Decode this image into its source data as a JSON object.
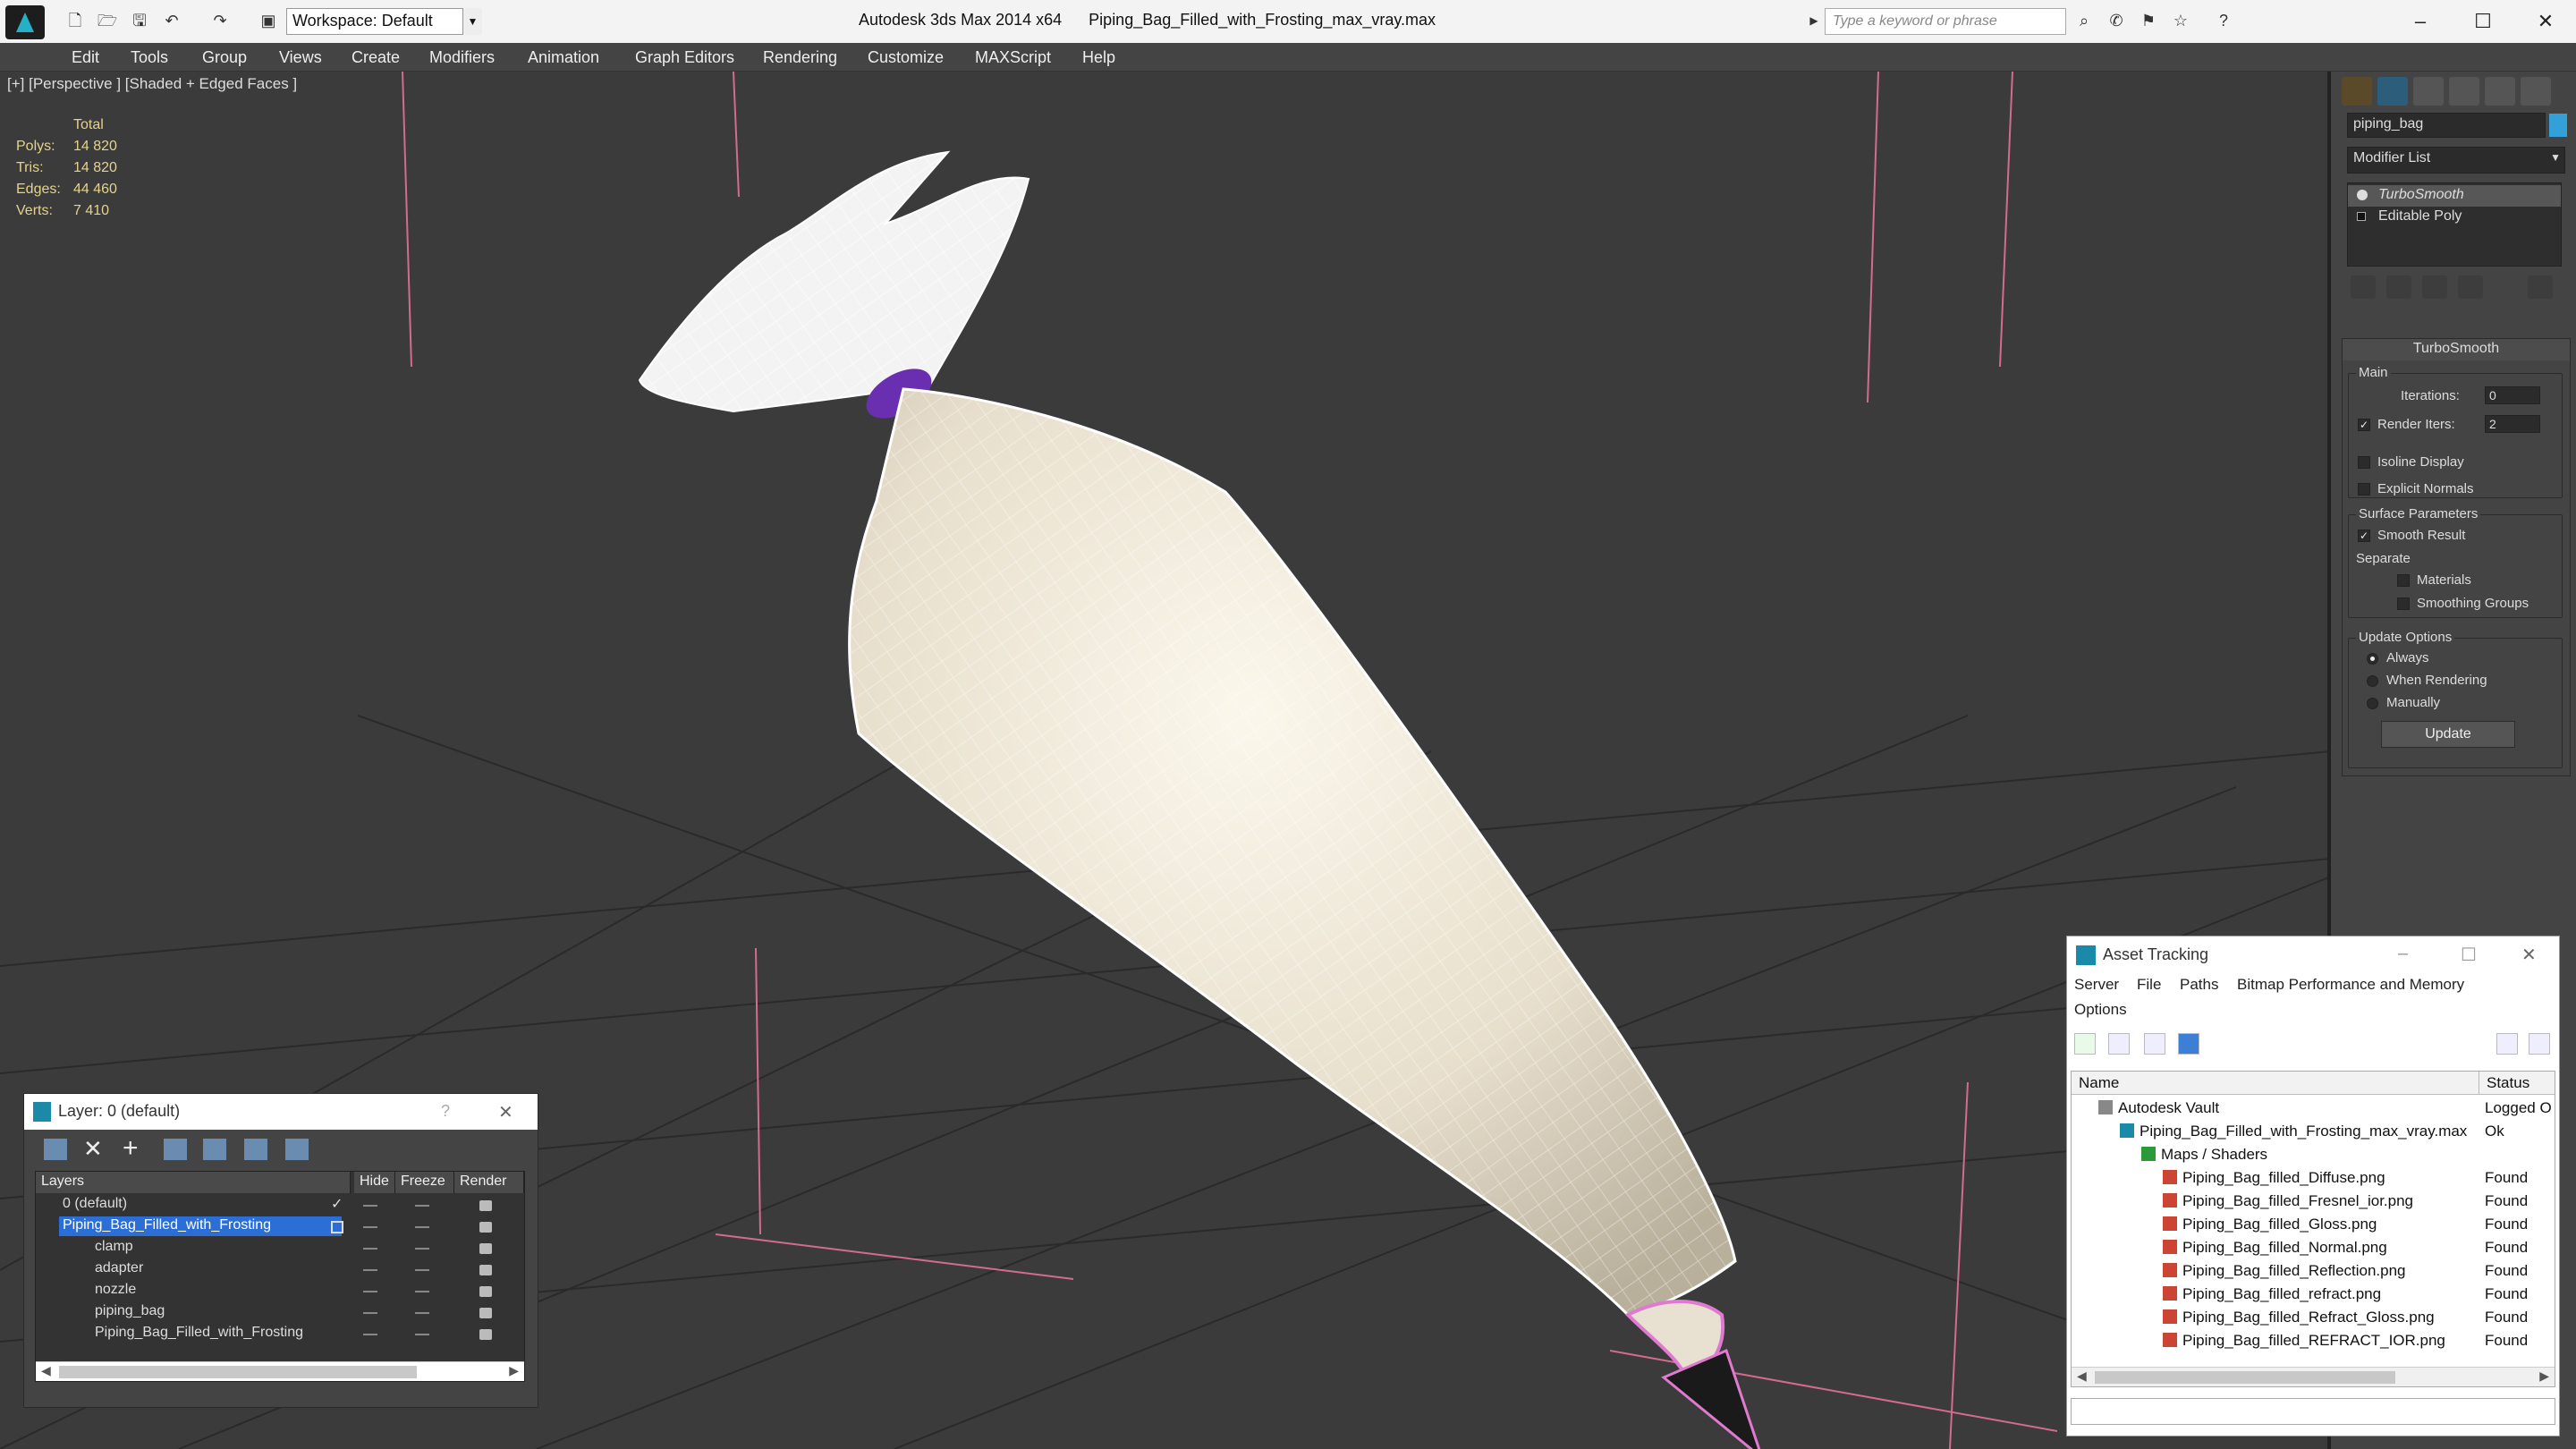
{
  "titlebar": {
    "app": "Autodesk 3ds Max 2014 x64",
    "file": "Piping_Bag_Filled_with_Frosting_max_vray.max",
    "workspace": "Workspace: Default",
    "search_placeholder": "Type a keyword or phrase",
    "minimize": "–",
    "maximize": "☐",
    "close": "✕"
  },
  "menu": [
    "Edit",
    "Tools",
    "Group",
    "Views",
    "Create",
    "Modifiers",
    "Animation",
    "Graph Editors",
    "Rendering",
    "Customize",
    "MAXScript",
    "Help"
  ],
  "viewport": {
    "label": "[+] [Perspective ] [Shaded + Edged Faces ]",
    "stats_header": "Total",
    "stats": [
      {
        "k": "Polys:",
        "v": "14 820"
      },
      {
        "k": "Tris:",
        "v": "14 820"
      },
      {
        "k": "Edges:",
        "v": "44 460"
      },
      {
        "k": "Verts:",
        "v": "7 410"
      }
    ]
  },
  "command_panel": {
    "object_name": "piping_bag",
    "modifier_list": "Modifier List",
    "stack": [
      "TurboSmooth",
      "Editable Poly"
    ],
    "rollout_title": "TurboSmooth",
    "main_label": "Main",
    "iterations_label": "Iterations:",
    "iterations_value": "0",
    "render_iters_label": "Render Iters:",
    "render_iters_value": "2",
    "isoline": "Isoline Display",
    "explicit_normals": "Explicit Normals",
    "surface_params": "Surface Parameters",
    "smooth_result": "Smooth Result",
    "separate": "Separate",
    "materials": "Materials",
    "smoothing_groups": "Smoothing Groups",
    "update_options": "Update Options",
    "always": "Always",
    "when_rendering": "When Rendering",
    "manually": "Manually",
    "update_button": "Update",
    "colors": {
      "swatch": "#33a0d8"
    }
  },
  "asset_tracking": {
    "title": "Asset Tracking",
    "menu": [
      "Server",
      "File",
      "Paths",
      "Bitmap Performance and Memory",
      "Options"
    ],
    "col_name": "Name",
    "col_status": "Status",
    "rows": [
      {
        "name": "Autodesk Vault",
        "status": "Logged O"
      },
      {
        "name": "Piping_Bag_Filled_with_Frosting_max_vray.max",
        "status": "Ok"
      },
      {
        "name": "Maps / Shaders",
        "status": ""
      },
      {
        "name": "Piping_Bag_filled_Diffuse.png",
        "status": "Found"
      },
      {
        "name": "Piping_Bag_filled_Fresnel_ior.png",
        "status": "Found"
      },
      {
        "name": "Piping_Bag_filled_Gloss.png",
        "status": "Found"
      },
      {
        "name": "Piping_Bag_filled_Normal.png",
        "status": "Found"
      },
      {
        "name": "Piping_Bag_filled_Reflection.png",
        "status": "Found"
      },
      {
        "name": "Piping_Bag_filled_refract.png",
        "status": "Found"
      },
      {
        "name": "Piping_Bag_filled_Refract_Gloss.png",
        "status": "Found"
      },
      {
        "name": "Piping_Bag_filled_REFRACT_IOR.png",
        "status": "Found"
      }
    ]
  },
  "layers": {
    "title": "Layer: 0 (default)",
    "help": "?",
    "close": "✕",
    "col_layers": "Layers",
    "col_hide": "Hide",
    "col_freeze": "Freeze",
    "col_render": "Render",
    "rows": [
      {
        "name": "0 (default)"
      },
      {
        "name": "Piping_Bag_Filled_with_Frosting"
      },
      {
        "name": "clamp"
      },
      {
        "name": "adapter"
      },
      {
        "name": "nozzle"
      },
      {
        "name": "piping_bag"
      },
      {
        "name": "Piping_Bag_Filled_with_Frosting"
      }
    ]
  }
}
